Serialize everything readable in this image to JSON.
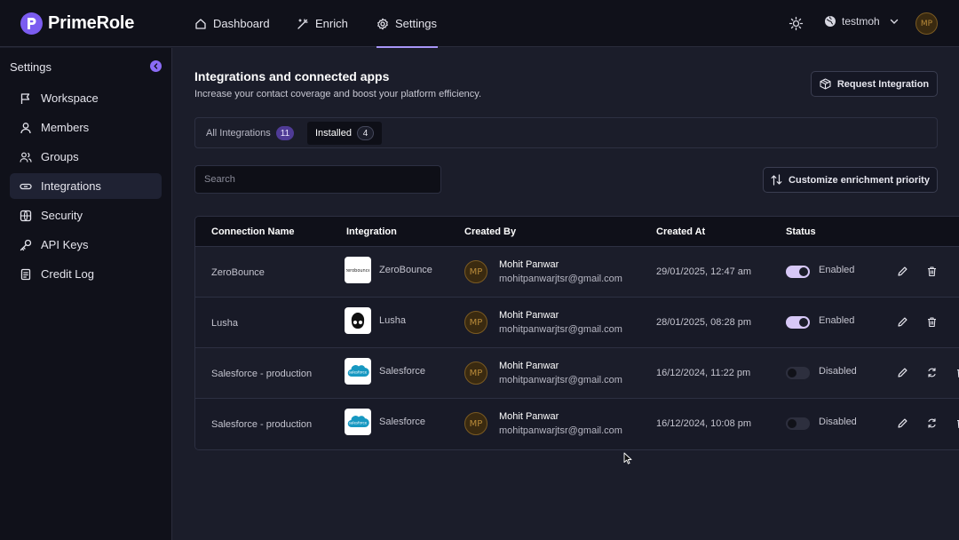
{
  "app": {
    "name": "PrimeRole",
    "brand_color": "#7b5cf0"
  },
  "nav": {
    "tabs": [
      {
        "label": "Dashboard",
        "icon": "home-icon"
      },
      {
        "label": "Enrich",
        "icon": "wand-icon"
      },
      {
        "label": "Settings",
        "icon": "gear-icon",
        "active": true
      }
    ]
  },
  "user": {
    "name": "testmoh",
    "initials": "MP"
  },
  "sidebar": {
    "title": "Settings",
    "items": [
      {
        "label": "Workspace",
        "icon": "flag-icon"
      },
      {
        "label": "Members",
        "icon": "user-icon"
      },
      {
        "label": "Groups",
        "icon": "users-icon"
      },
      {
        "label": "Integrations",
        "icon": "link-icon",
        "active": true
      },
      {
        "label": "Security",
        "icon": "globe-icon"
      },
      {
        "label": "API Keys",
        "icon": "key-icon"
      },
      {
        "label": "Credit Log",
        "icon": "document-icon"
      }
    ]
  },
  "main": {
    "title": "Integrations and connected apps",
    "subtitle": "Increase your contact coverage and boost your platform efficiency.",
    "request_button": "Request Integration",
    "customize_button": "Customize enrichment priority",
    "tabs": [
      {
        "label": "All Integrations",
        "count": "11"
      },
      {
        "label": "Installed",
        "count": "4",
        "active": true
      }
    ],
    "search_placeholder": "Search"
  },
  "table": {
    "columns": [
      "Connection Name",
      "Integration",
      "Created By",
      "Created At",
      "Status"
    ],
    "rows": [
      {
        "connection": "ZeroBounce",
        "integration": "ZeroBounce",
        "logo": "zerobounce-logo",
        "creator": "Mohit Panwar",
        "email": "mohitpanwarjtsr@gmail.com",
        "created_at": "29/01/2025, 12:47 am",
        "status": "Enabled",
        "enabled": true
      },
      {
        "connection": "Lusha",
        "integration": "Lusha",
        "logo": "lusha-logo",
        "creator": "Mohit Panwar",
        "email": "mohitpanwarjtsr@gmail.com",
        "created_at": "28/01/2025, 08:28 pm",
        "status": "Enabled",
        "enabled": true
      },
      {
        "connection": "Salesforce - production",
        "integration": "Salesforce",
        "logo": "salesforce-logo",
        "creator": "Mohit Panwar",
        "email": "mohitpanwarjtsr@gmail.com",
        "created_at": "16/12/2024, 11:22 pm",
        "status": "Disabled",
        "enabled": false
      },
      {
        "connection": "Salesforce - production",
        "integration": "Salesforce",
        "logo": "salesforce-logo",
        "creator": "Mohit Panwar",
        "email": "mohitpanwarjtsr@gmail.com",
        "created_at": "16/12/2024, 10:08 pm",
        "status": "Disabled",
        "enabled": false
      }
    ]
  }
}
